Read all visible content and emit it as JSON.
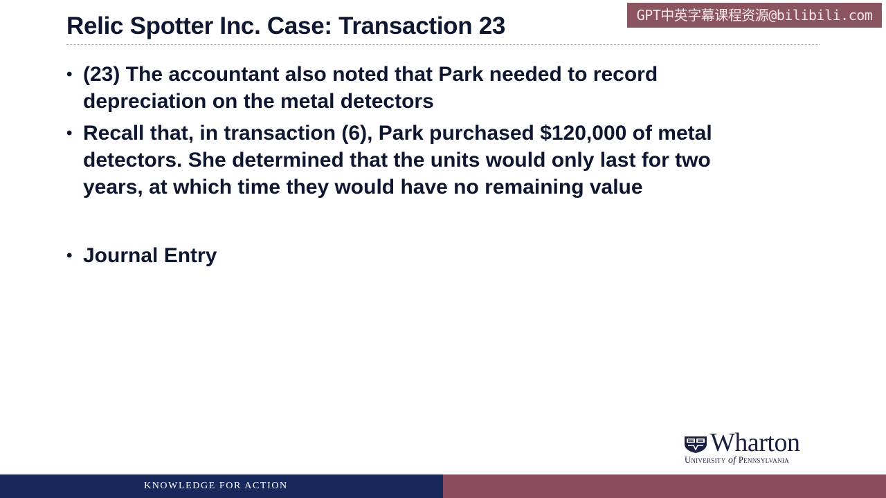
{
  "watermark": "GPT中英字幕课程资源@bilibili.com",
  "title": "Relic Spotter Inc. Case: Transaction 23",
  "bullets": [
    {
      "marker": "•",
      "text": "(23) The accountant also noted that Park needed to record depreciation on the metal detectors"
    },
    {
      "marker": "•",
      "text": "Recall that, in transaction (6), Park purchased $120,000 of metal detectors. She determined that the units would only last for two years, at which time they would have no remaining value"
    },
    {
      "marker": "•",
      "text": "Journal Entry"
    }
  ],
  "logo": {
    "icon": "shield-icon",
    "word": "Wharton",
    "sub_before": "University ",
    "sub_of": "of",
    "sub_after": " Pennsylvania"
  },
  "footer": {
    "tagline": "KNOWLEDGE FOR ACTION",
    "colors": {
      "left": "#17285a",
      "right": "#8a4b5e"
    }
  }
}
